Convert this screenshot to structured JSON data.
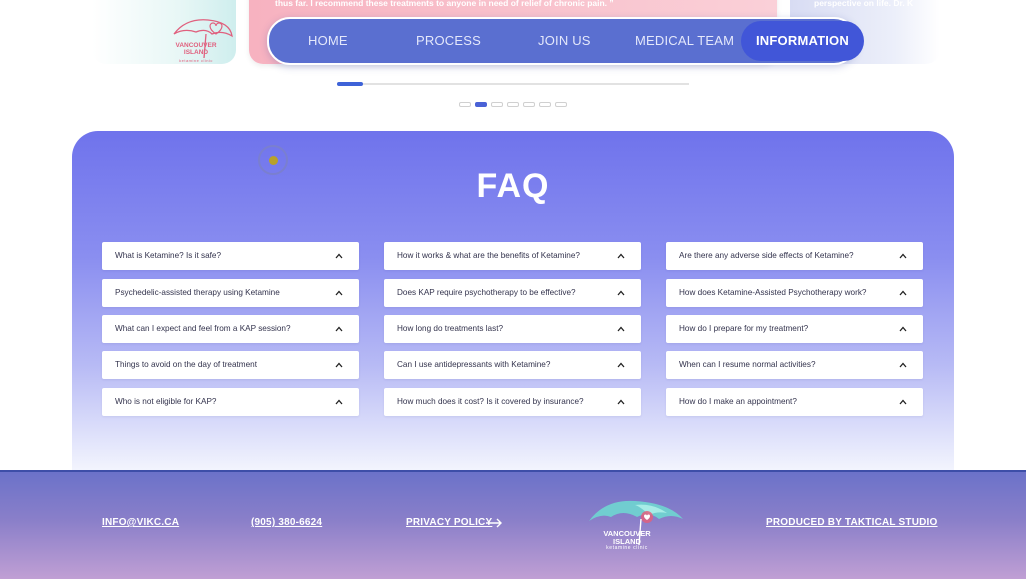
{
  "carousel": {
    "center_quote": "thus far. I recommend these treatments to anyone in need of relief of chronic pain. ”",
    "right_quote": "perspective on life. Dr. K",
    "progress_fraction": 0.075,
    "slide_count": 7,
    "active_slide": 1
  },
  "logo": {
    "line1": "VANCOUVER",
    "line2": "ISLAND",
    "sub": "ketamine clinic"
  },
  "nav": {
    "items": [
      "HOME",
      "PROCESS",
      "JOIN US",
      "MEDICAL TEAM",
      "INFORMATION"
    ],
    "active": "INFORMATION"
  },
  "faq": {
    "title": "FAQ",
    "columns": [
      [
        "What is Ketamine? Is it safe?",
        "Psychedelic-assisted therapy using Ketamine",
        "What can I expect and feel from a KAP session?",
        "Things to avoid on the day of treatment",
        "Who is not eligible for KAP?"
      ],
      [
        "How it works & what are the benefits of Ketamine?",
        "Does KAP require psychotherapy to be effective?",
        "How long do treatments last?",
        "Can I use antidepressants with Ketamine?",
        "How much does it cost? Is it covered by insurance?"
      ],
      [
        "Are there any adverse side effects of Ketamine?",
        "How does Ketamine-Assisted Psychotherapy work?",
        "How do I prepare for my treatment?",
        "When can I resume normal activities?",
        "How do I make an appointment?"
      ]
    ]
  },
  "footer": {
    "email": "INFO@VIKC.CA",
    "phone": "(905) 380-6624",
    "privacy": "PRIVACY POLICY",
    "credit": "PRODUCED BY TAKTICAL STUDIO"
  },
  "colors": {
    "nav_bg": "#5a6fd0",
    "nav_active": "#4156d8",
    "faq_top": "#6f73ec",
    "logo_pink": "#e0607e",
    "logo_teal": "#6fd6d0"
  },
  "icons": [
    "chevron-up-icon",
    "arrow-right-icon",
    "cursor-ring-icon"
  ]
}
